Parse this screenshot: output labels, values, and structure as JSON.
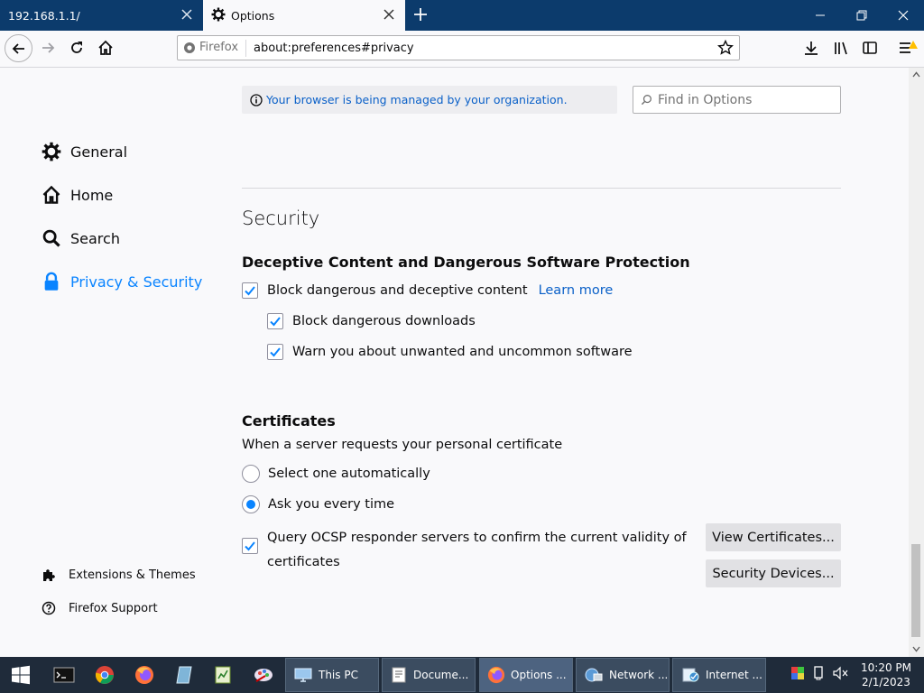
{
  "tabs": [
    {
      "title": "192.168.1.1/",
      "active": false
    },
    {
      "title": "Options",
      "active": true
    }
  ],
  "urlbar": {
    "identity_label": "Firefox",
    "url": "about:preferences#privacy"
  },
  "managed_notice": "Your browser is being managed by your organization.",
  "find": {
    "placeholder": "Find in Options"
  },
  "categories": [
    {
      "label": "General",
      "icon": "gear-icon"
    },
    {
      "label": "Home",
      "icon": "home-icon"
    },
    {
      "label": "Search",
      "icon": "search-icon"
    },
    {
      "label": "Privacy & Security",
      "icon": "lock-icon",
      "selected": true
    }
  ],
  "footer_links": [
    {
      "label": "Extensions & Themes",
      "icon": "puzzle-icon"
    },
    {
      "label": "Firefox Support",
      "icon": "help-icon"
    }
  ],
  "section_title": "Security",
  "deceptive": {
    "heading": "Deceptive Content and Dangerous Software Protection",
    "block_label": "Block dangerous and deceptive content",
    "learn_more": "Learn more",
    "downloads_label": "Block dangerous downloads",
    "unwanted_label": "Warn you about unwanted and uncommon software"
  },
  "certificates": {
    "heading": "Certificates",
    "prompt": "When a server requests your personal certificate",
    "radio_auto": "Select one automatically",
    "radio_ask": "Ask you every time",
    "ocsp_line1": "Query OCSP responder servers to confirm the current validity of",
    "ocsp_line2": "certificates",
    "view_button": "View Certificates...",
    "devices_button": "Security Devices..."
  },
  "taskbar": {
    "tasks": [
      {
        "label": "This PC",
        "icon": "computer-icon"
      },
      {
        "label": "Docume...",
        "icon": "document-icon"
      },
      {
        "label": "Options ...",
        "icon": "firefox-icon",
        "active": true
      },
      {
        "label": "Network ...",
        "icon": "network-icon"
      },
      {
        "label": "Internet ...",
        "icon": "internet-icon"
      }
    ],
    "time": "10:20 PM",
    "date": "2/1/2023"
  },
  "colors": {
    "accent": "#0a84ff",
    "tabbar": "#0c3b6c",
    "taskbar": "#1f2b3a"
  }
}
